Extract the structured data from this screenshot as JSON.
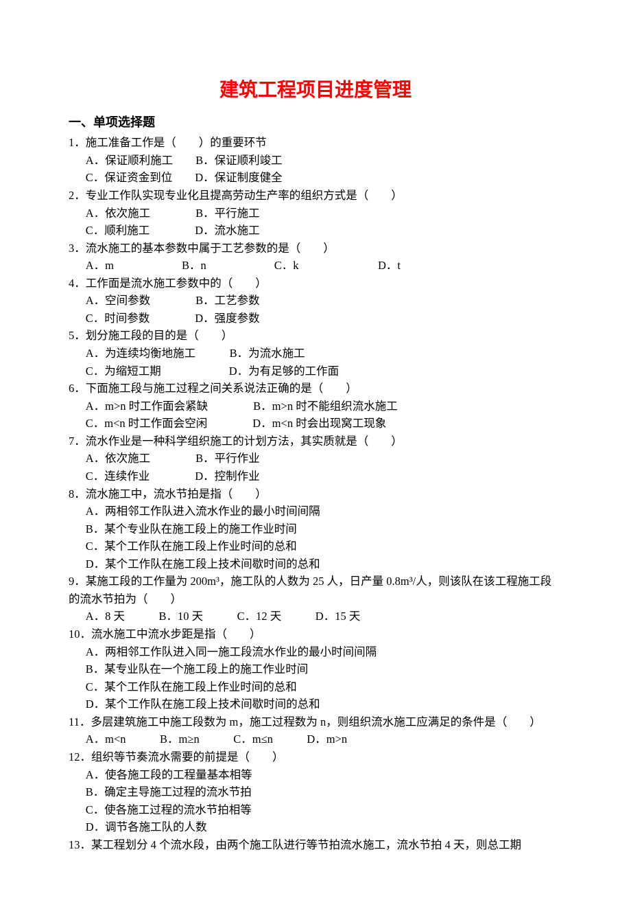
{
  "title": "建筑工程项目进度管理",
  "section_header": "一、单项选择题",
  "questions": [
    {
      "text": "1．施工准备工作是（　　）的重要环节",
      "option_lines": [
        "A．保证顺利施工　　B．保证顺利竣工",
        "C．保证资金到位　　D．保证制度健全"
      ]
    },
    {
      "text": "2．专业工作队实现专业化且提高劳动生产率的组织方式是（　　）",
      "option_lines": [
        "A．依次施工　　　　B．平行施工",
        "C．顺利施工　　　　D．流水施工"
      ]
    },
    {
      "text": "3．流水施工的基本参数中属于工艺参数的是（　　）",
      "option_lines": [
        "A．m　　　　　　B．n　　　　　　C．k　　　　　　　D．t"
      ]
    },
    {
      "text": "4．工作面是流水施工参数中的（　　）",
      "option_lines": [
        "A．空间参数　　　　B．工艺参数",
        "C．时间参数　　　　D．强度参数"
      ]
    },
    {
      "text": "5．划分施工段的目的是（　　）",
      "option_lines": [
        "A．为连续均衡地施工　　　B．为流水施工",
        "C．为缩短工期　　　　　　D．为有足够的工作面"
      ]
    },
    {
      "text": "6．下面施工段与施工过程之间关系说法正确的是（　　）",
      "option_lines": [
        "A．m>n 时工作面会紧缺　　　　B．m>n 时不能组织流水施工",
        "C．m<n 时工作面会空闲　　　　D．m<n 时会出现窝工现象"
      ]
    },
    {
      "text": "7．流水作业是一种科学组织施工的计划方法，其实质就是（　　）",
      "option_lines": [
        "A．依次施工　　　　B．平行作业",
        "C．连续作业　　　　D．控制作业"
      ]
    },
    {
      "text": "8．流水施工中，流水节拍是指（　　）",
      "option_lines": [
        "A．两相邻工作队进入流水作业的最小时间间隔",
        "B．某个专业队在施工段上的施工作业时间",
        "C．某个工作队在施工段上作业时间的总和",
        "D．某个工作队在施工段上技术间歇时间的总和"
      ]
    },
    {
      "text": "9．某施工段的工作量为 200m³，施工队的人数为 25 人，日产量 0.8m³/人，则该队在该工程施工段的流水节拍为（　　）",
      "option_lines": [
        "A．8 天　　　B．10 天　　　C．12 天　　　D．15 天"
      ]
    },
    {
      "text": "10．流水施工中流水步距是指（　　）",
      "option_lines": [
        "A．两相邻工作队进入同一施工段流水作业的最小时间间隔",
        "B．某专业队在一个施工段上的施工作业时间",
        "C．某个工作队在施工段上作业时间的总和",
        "D．某个工作队在施工段上技术间歇时间的总和"
      ]
    },
    {
      "text": "11．多层建筑施工中施工段数为 m，施工过程数为 n，则组织流水施工应满足的条件是（　　）",
      "option_lines": [
        "A．m<n　　　B．m≥n　　　C．m≤n　　　D．m>n"
      ]
    },
    {
      "text": "12．组织等节奏流水需要的前提是（　　）",
      "option_lines": [
        "A．使各施工段的工程量基本相等",
        "B．确定主导施工过程的流水节拍",
        "C．使各施工过程的流水节拍相等",
        "D．调节各施工队的人数"
      ]
    },
    {
      "text": "13．某工程划分 4 个流水段，由两个施工队进行等节拍流水施工，流水节拍 4 天，则总工期",
      "option_lines": []
    }
  ]
}
